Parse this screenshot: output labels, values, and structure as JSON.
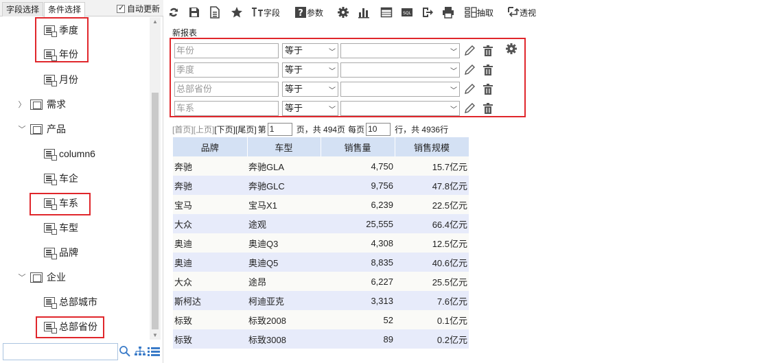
{
  "left_panel": {
    "tabs": [
      {
        "label": "字段选择"
      },
      {
        "label": "条件选择"
      }
    ],
    "auto_update_label": "自动更新",
    "auto_update_checked": true,
    "tree": [
      {
        "label": "季度",
        "kind": "field",
        "highlighted": true
      },
      {
        "label": "年份",
        "kind": "field",
        "highlighted": true
      },
      {
        "label": "月份",
        "kind": "field"
      },
      {
        "label": "需求",
        "kind": "group",
        "expanded": false
      },
      {
        "label": "产品",
        "kind": "group",
        "expanded": true
      },
      {
        "label": "column6",
        "kind": "field"
      },
      {
        "label": "车企",
        "kind": "field"
      },
      {
        "label": "车系",
        "kind": "field",
        "highlighted": true
      },
      {
        "label": "车型",
        "kind": "field"
      },
      {
        "label": "品牌",
        "kind": "field"
      },
      {
        "label": "企业",
        "kind": "group",
        "expanded": true
      },
      {
        "label": "总部城市",
        "kind": "field"
      },
      {
        "label": "总部省份",
        "kind": "field",
        "highlighted": true
      }
    ],
    "search_value": ""
  },
  "toolbar": {
    "field_label": "字段",
    "param_label": "参数",
    "extract_label": "抽取",
    "pivot_label": "透视",
    "icons": [
      "refresh-icon",
      "save-icon",
      "save-as-icon",
      "star-icon",
      "field-icon",
      "param-icon",
      "gear-icon",
      "chart-icon",
      "table-icon",
      "sql-icon",
      "export-icon",
      "print-icon",
      "extract-icon",
      "pivot-icon"
    ]
  },
  "report": {
    "title": "新报表",
    "filters": [
      {
        "field": "年份",
        "operator": "等于",
        "value": ""
      },
      {
        "field": "季度",
        "operator": "等于",
        "value": ""
      },
      {
        "field": "总部省份",
        "operator": "等于",
        "value": ""
      },
      {
        "field": "车系",
        "operator": "等于",
        "value": ""
      }
    ],
    "pager": {
      "first": "[首页]",
      "prev": "[上页]",
      "next": "[下页]",
      "last": "[尾页]",
      "page_prefix": "第",
      "page_value": "1",
      "page_suffix": "页，共 494页",
      "per_page_prefix": "每页",
      "per_page_value": "10",
      "per_page_suffix": "行，共 4936行"
    },
    "table": {
      "columns": [
        "品牌",
        "车型",
        "销售量",
        "销售规模"
      ],
      "rows": [
        [
          "奔驰",
          "奔驰GLA",
          "4,750",
          "15.7亿元"
        ],
        [
          "奔驰",
          "奔驰GLC",
          "9,756",
          "47.8亿元"
        ],
        [
          "宝马",
          "宝马X1",
          "6,239",
          "22.5亿元"
        ],
        [
          "大众",
          "途观",
          "25,555",
          "66.4亿元"
        ],
        [
          "奥迪",
          "奥迪Q3",
          "4,308",
          "12.5亿元"
        ],
        [
          "奥迪",
          "奥迪Q5",
          "8,835",
          "40.6亿元"
        ],
        [
          "大众",
          "途昂",
          "6,227",
          "25.5亿元"
        ],
        [
          "斯柯达",
          "柯迪亚克",
          "3,313",
          "7.6亿元"
        ],
        [
          "标致",
          "标致2008",
          "52",
          "0.1亿元"
        ],
        [
          "标致",
          "标致3008",
          "89",
          "0.2亿元"
        ]
      ]
    }
  },
  "colors": {
    "highlight_border": "#e0262b",
    "header_bg": "#d4e1f4",
    "row_alt_bg": "#e7ebfa"
  }
}
